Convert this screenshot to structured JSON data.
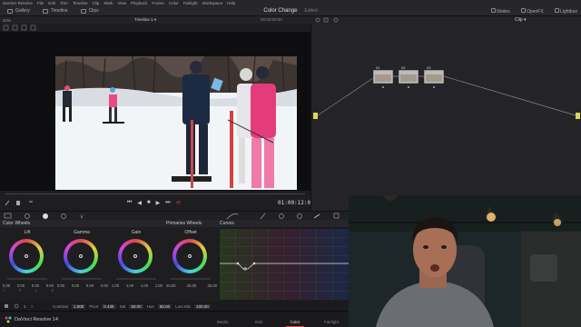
{
  "menu": [
    "DaVinci Resolve",
    "File",
    "Edit",
    "Trim",
    "Timeline",
    "Clip",
    "Mark",
    "View",
    "Playback",
    "Fusion",
    "Color",
    "Fairlight",
    "Workspace",
    "Help"
  ],
  "toolbar": {
    "gallery": "Gallery",
    "timeline": "Timeline",
    "clips": "Clips",
    "title": "Color Change",
    "edited": "Edited",
    "nodes": "Nodes",
    "openfx": "OpenFX",
    "lightbox": "Lightbox"
  },
  "viewer": {
    "zoom": "42%",
    "timeline_name": "Timeline 1",
    "source_tc": "00:00:00:00",
    "timecode": "01:00:12:08"
  },
  "node_editor": {
    "clip_mode": "Clip",
    "nodes": [
      "01",
      "02",
      "03"
    ]
  },
  "color_wheels": {
    "title": "Color Wheels",
    "mode": "Primaries Wheels",
    "wheels": [
      {
        "label": "Lift",
        "values": [
          "0.00",
          "0.00",
          "0.00",
          "0.00"
        ]
      },
      {
        "label": "Gamma",
        "values": [
          "0.00",
          "0.00",
          "0.00",
          "0.00"
        ]
      },
      {
        "label": "Gain",
        "values": [
          "1.00",
          "1.00",
          "1.00",
          "1.00"
        ]
      },
      {
        "label": "Offset",
        "values": [
          "25.00",
          "25.00",
          "25.00"
        ]
      }
    ],
    "channels": [
      "Y",
      "R",
      "G",
      "B"
    ]
  },
  "curves": {
    "title": "Curves"
  },
  "adjust": {
    "contrast_label": "Contrast",
    "contrast": "1.000",
    "pivot_label": "Pivot",
    "pivot": "0.435",
    "sat_label": "Sat",
    "sat": "50.00",
    "hue_label": "Hue",
    "hue": "50.00",
    "lum_mix_label": "Lum Mix",
    "lum_mix": "100.00"
  },
  "bottom": {
    "brand": "DaVinci Resolve 14",
    "pages": [
      "Media",
      "Edit",
      "Color",
      "Fairlight"
    ],
    "active_page": "Color"
  },
  "colors": {
    "accent": "#e0405a",
    "panel": "#1e1e21"
  }
}
